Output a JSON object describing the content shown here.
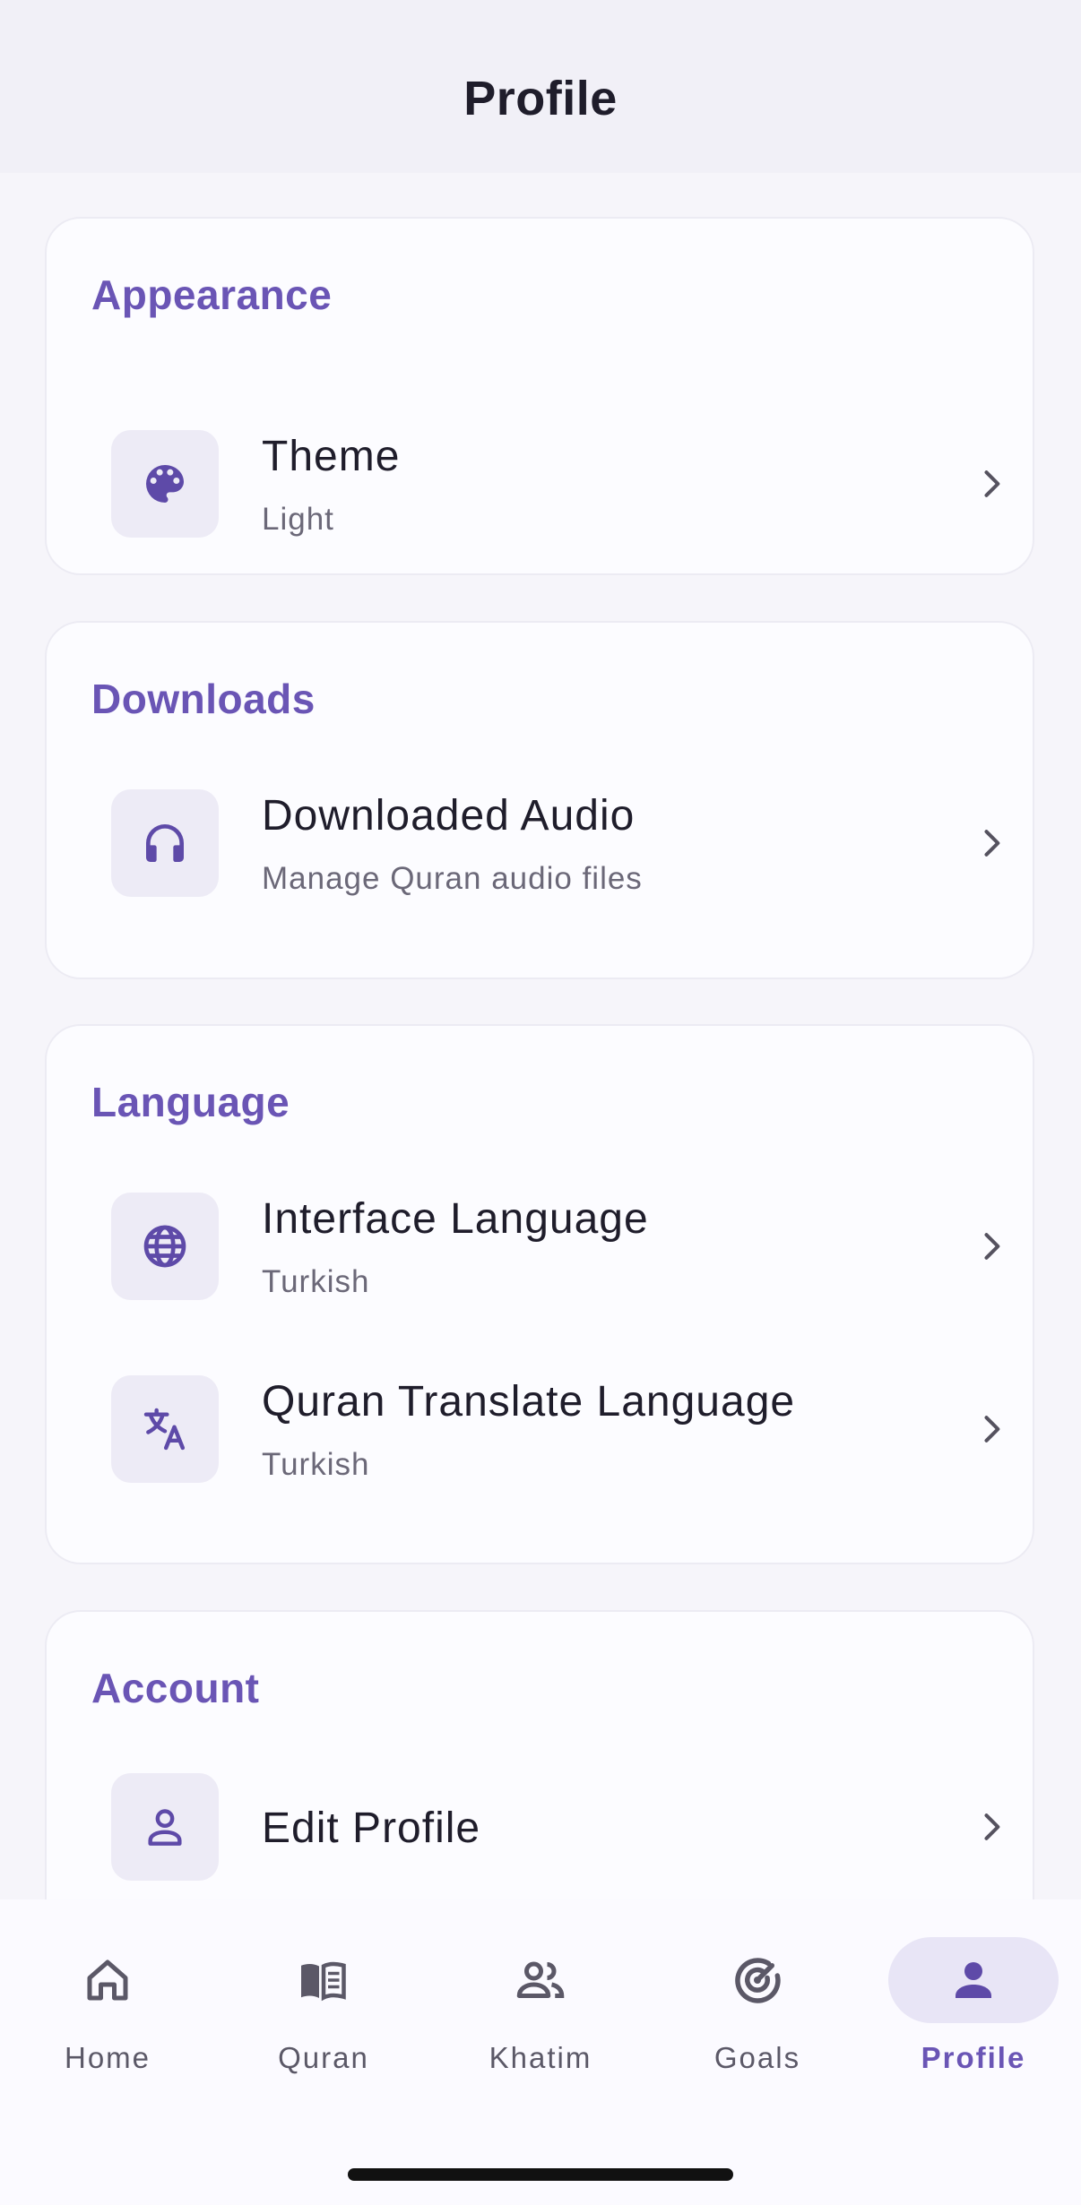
{
  "header": {
    "title": "Profile"
  },
  "sections": {
    "appearance": {
      "title": "Appearance",
      "theme": {
        "title": "Theme",
        "subtitle": "Light",
        "icon": "palette-icon"
      }
    },
    "downloads": {
      "title": "Downloads",
      "audio": {
        "title": "Downloaded Audio",
        "subtitle": "Manage Quran audio files",
        "icon": "headphones-icon"
      }
    },
    "language": {
      "title": "Language",
      "interface": {
        "title": "Interface Language",
        "subtitle": "Turkish",
        "icon": "globe-icon"
      },
      "translate": {
        "title": "Quran Translate Language",
        "subtitle": "Turkish",
        "icon": "translate-icon"
      }
    },
    "account": {
      "title": "Account",
      "edit_profile": {
        "title": "Edit Profile",
        "icon": "person-outline-icon"
      }
    }
  },
  "tabbar": {
    "home": "Home",
    "quran": "Quran",
    "khatim": "Khatim",
    "goals": "Goals",
    "profile": "Profile",
    "active": "profile"
  },
  "colors": {
    "accent": "#6a55b5",
    "background": "#f6f5fa",
    "card": "#fcfcff",
    "icon_bg": "#edebf6"
  }
}
